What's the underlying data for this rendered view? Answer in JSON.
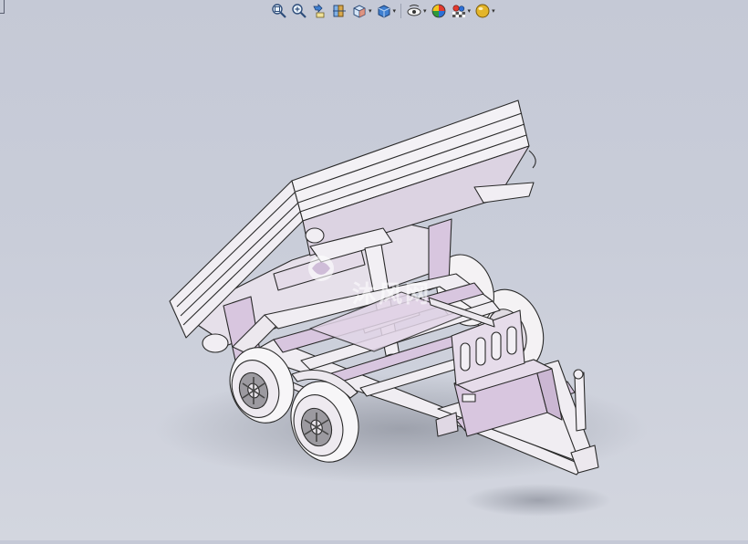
{
  "window": {
    "background_top": "#c5c9d6",
    "background_bottom": "#d3d6df"
  },
  "toolbar": {
    "items": [
      {
        "name": "zoom-to-fit",
        "icon": "zoom-fit-icon",
        "has_dropdown": false
      },
      {
        "name": "zoom-to-area",
        "icon": "zoom-area-icon",
        "has_dropdown": false
      },
      {
        "name": "previous-view",
        "icon": "previous-view-icon",
        "has_dropdown": false
      },
      {
        "name": "section-view",
        "icon": "section-view-icon",
        "has_dropdown": false
      },
      {
        "name": "view-orientation",
        "icon": "view-orientation-icon",
        "has_dropdown": true
      },
      {
        "name": "display-style",
        "icon": "display-style-icon",
        "has_dropdown": true
      },
      {
        "name": "hide-show-items",
        "icon": "hide-show-icon",
        "has_dropdown": true
      },
      {
        "name": "edit-appearance",
        "icon": "appearance-icon",
        "has_dropdown": false
      },
      {
        "name": "apply-scene",
        "icon": "scene-icon",
        "has_dropdown": true
      },
      {
        "name": "view-settings",
        "icon": "view-settings-icon",
        "has_dropdown": true
      }
    ]
  },
  "model": {
    "name": "tipping-trailer-assembly",
    "colors": {
      "body": "#ece8ee",
      "accent": "#d8c6df",
      "edge": "#2a2a2a",
      "tire": "#f2f2f2",
      "shadow": "#9ea2ad"
    }
  },
  "watermark": {
    "text": "沐风网"
  }
}
